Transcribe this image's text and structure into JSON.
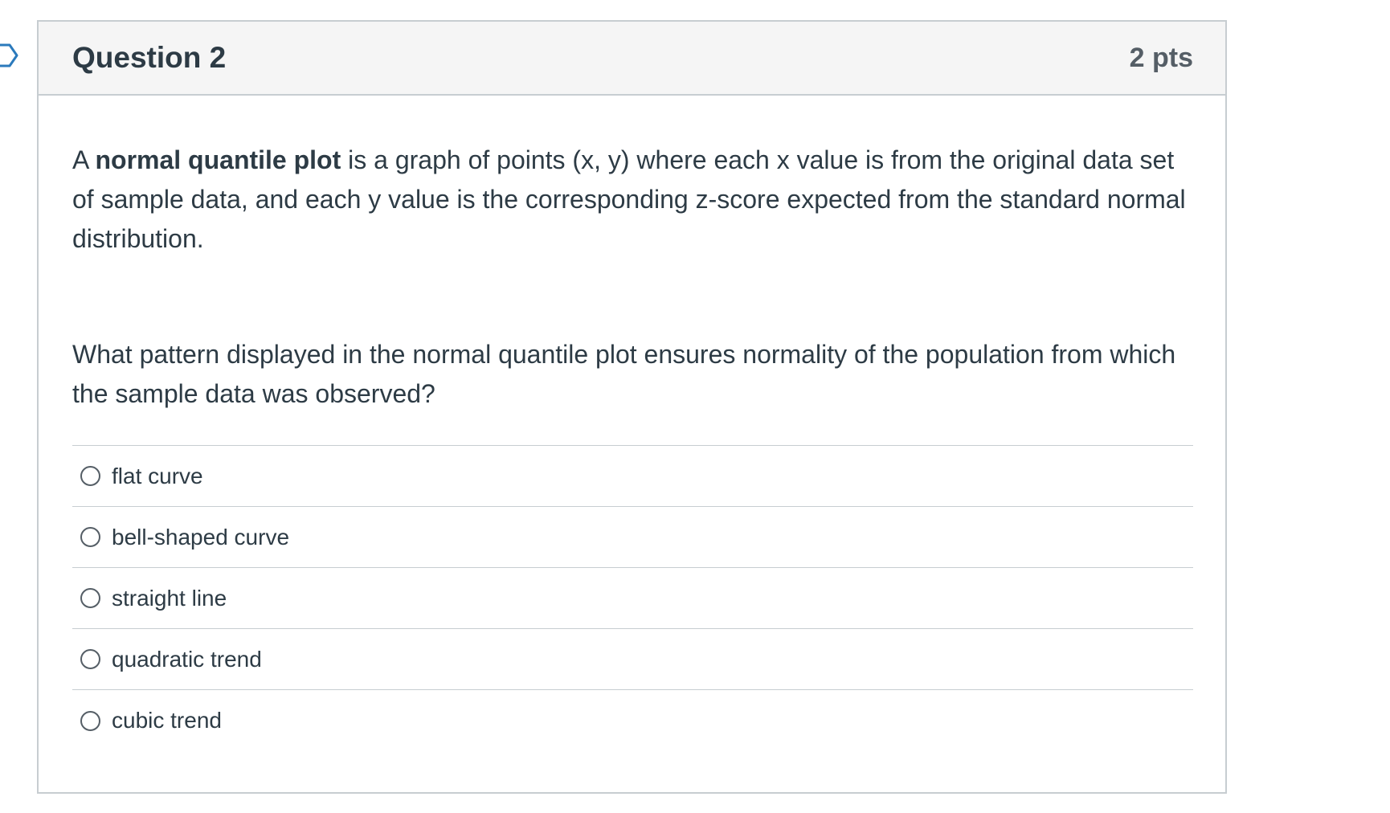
{
  "header": {
    "title": "Question 2",
    "points": "2 pts"
  },
  "body": {
    "intro_prefix": "A ",
    "intro_bold": "normal quantile plot",
    "intro_rest": " is a graph of points (x, y) where each x value is from the original data set of sample data, and each y value is the corresponding z-score expected from the standard normal distribution.",
    "question": "What pattern displayed in the normal quantile plot ensures normality of the population from which the sample data was observed?"
  },
  "answers": [
    {
      "label": "flat curve"
    },
    {
      "label": "bell-shaped curve"
    },
    {
      "label": "straight line"
    },
    {
      "label": "quadratic trend"
    },
    {
      "label": "cubic trend"
    }
  ],
  "colors": {
    "border": "#c7cdd1",
    "header_bg": "#f5f5f5",
    "text": "#2d3b45",
    "flag": "#2b7abc"
  },
  "icons": {
    "flag": "bookmark-flag-icon",
    "radio": "radio-unchecked-icon"
  }
}
